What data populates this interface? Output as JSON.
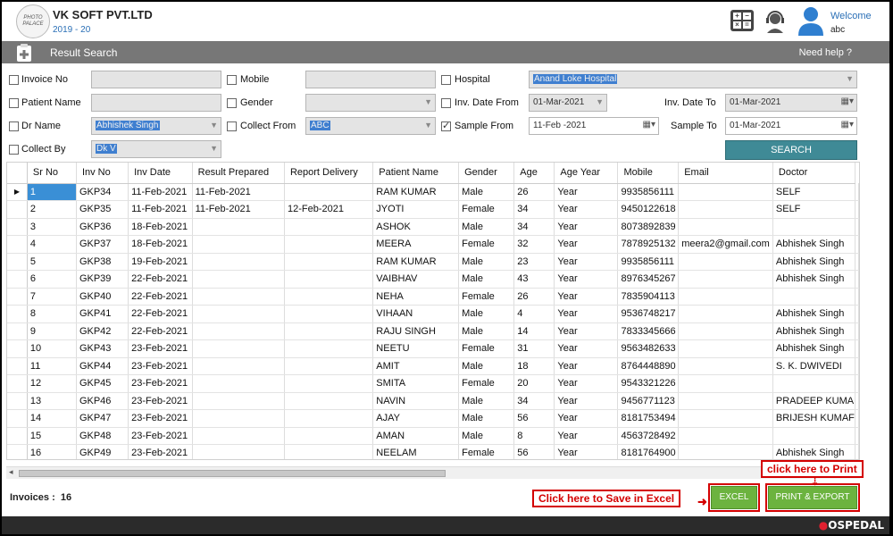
{
  "app": {
    "company": "VK SOFT PVT.LTD",
    "financial_year": "2019 - 20",
    "logo_text": "PHOTO PALACE",
    "welcome": "Welcome",
    "user": "abc"
  },
  "titlebar": {
    "title": "Result Search",
    "help": "Need help ?"
  },
  "filters": {
    "invoice_no": {
      "label": "Invoice No",
      "value": ""
    },
    "mobile": {
      "label": "Mobile",
      "value": ""
    },
    "hospital": {
      "label": "Hospital",
      "value": "Anand Loke Hospital"
    },
    "patient_name": {
      "label": "Patient Name",
      "value": ""
    },
    "gender": {
      "label": "Gender",
      "value": ""
    },
    "inv_date_from": {
      "label": "Inv. Date From",
      "value": "01-Mar-2021"
    },
    "inv_date_to": {
      "label": "Inv. Date To",
      "value": "01-Mar-2021"
    },
    "dr_name": {
      "label": "Dr Name",
      "value": "Abhishek Singh"
    },
    "collect_from": {
      "label": "Collect From",
      "value": "ABC"
    },
    "sample_from": {
      "label": "Sample From",
      "value": "11-Feb -2021",
      "checked": true
    },
    "sample_to": {
      "label": "Sample To",
      "value": "01-Mar-2021"
    },
    "collect_by": {
      "label": "Collect By",
      "value": "Dk V"
    },
    "search_label": "SEARCH"
  },
  "grid": {
    "columns": [
      "Sr No",
      "Inv No",
      "Inv Date",
      "Result Prepared",
      "Report Delivery",
      "Patient Name",
      "Gender",
      "Age",
      "Age Year",
      "Mobile",
      "Email",
      "Doctor"
    ],
    "rows": [
      [
        "1",
        "GKP34",
        "11-Feb-2021",
        "11-Feb-2021",
        "",
        "RAM KUMAR",
        "Male",
        "26",
        "Year",
        "9935856111",
        "",
        "SELF"
      ],
      [
        "2",
        "GKP35",
        "11-Feb-2021",
        "11-Feb-2021",
        "12-Feb-2021",
        "JYOTI",
        "Female",
        "34",
        "Year",
        "9450122618",
        "",
        "SELF"
      ],
      [
        "3",
        "GKP36",
        "18-Feb-2021",
        "",
        "",
        "ASHOK",
        "Male",
        "34",
        "Year",
        "8073892839",
        "",
        ""
      ],
      [
        "4",
        "GKP37",
        "18-Feb-2021",
        "",
        "",
        "MEERA",
        "Female",
        "32",
        "Year",
        "7878925132",
        "meera2@gmail.com",
        "Abhishek Singh"
      ],
      [
        "5",
        "GKP38",
        "19-Feb-2021",
        "",
        "",
        "RAM KUMAR",
        "Male",
        "23",
        "Year",
        "9935856111",
        "",
        "Abhishek Singh"
      ],
      [
        "6",
        "GKP39",
        "22-Feb-2021",
        "",
        "",
        "VAIBHAV",
        "Male",
        "43",
        "Year",
        "8976345267",
        "",
        "Abhishek Singh"
      ],
      [
        "7",
        "GKP40",
        "22-Feb-2021",
        "",
        "",
        "NEHA",
        "Female",
        "26",
        "Year",
        "7835904113",
        "",
        ""
      ],
      [
        "8",
        "GKP41",
        "22-Feb-2021",
        "",
        "",
        "VIHAAN",
        "Male",
        "4",
        "Year",
        "9536748217",
        "",
        "Abhishek Singh"
      ],
      [
        "9",
        "GKP42",
        "22-Feb-2021",
        "",
        "",
        "RAJU SINGH",
        "Male",
        "14",
        "Year",
        "7833345666",
        "",
        "Abhishek Singh"
      ],
      [
        "10",
        "GKP43",
        "23-Feb-2021",
        "",
        "",
        "NEETU",
        "Female",
        "31",
        "Year",
        "9563482633",
        "",
        "Abhishek Singh"
      ],
      [
        "11",
        "GKP44",
        "23-Feb-2021",
        "",
        "",
        "AMIT",
        "Male",
        "18",
        "Year",
        "8764448890",
        "",
        "S. K. DWIVEDI"
      ],
      [
        "12",
        "GKP45",
        "23-Feb-2021",
        "",
        "",
        "SMITA",
        "Female",
        "20",
        "Year",
        "9543321226",
        "",
        ""
      ],
      [
        "13",
        "GKP46",
        "23-Feb-2021",
        "",
        "",
        "NAVIN",
        "Male",
        "34",
        "Year",
        "9456771123",
        "",
        "PRADEEP KUMA"
      ],
      [
        "14",
        "GKP47",
        "23-Feb-2021",
        "",
        "",
        "AJAY",
        "Male",
        "56",
        "Year",
        "8181753494",
        "",
        "BRIJESH KUMAF"
      ],
      [
        "15",
        "GKP48",
        "23-Feb-2021",
        "",
        "",
        "AMAN",
        "Male",
        "8",
        "Year",
        "4563728492",
        "",
        ""
      ],
      [
        "16",
        "GKP49",
        "23-Feb-2021",
        "",
        "",
        "NEELAM",
        "Female",
        "56",
        "Year",
        "8181764900",
        "",
        "Abhishek Singh"
      ]
    ]
  },
  "footer": {
    "invoices_label": "Invoices :",
    "invoices_count": "16",
    "excel_label": "EXCEL",
    "print_label": "PRINT & EXPORT",
    "excel_callout": "Click here to Save in Excel",
    "print_callout": "click here to Print",
    "brand": "OSPEDAL"
  }
}
